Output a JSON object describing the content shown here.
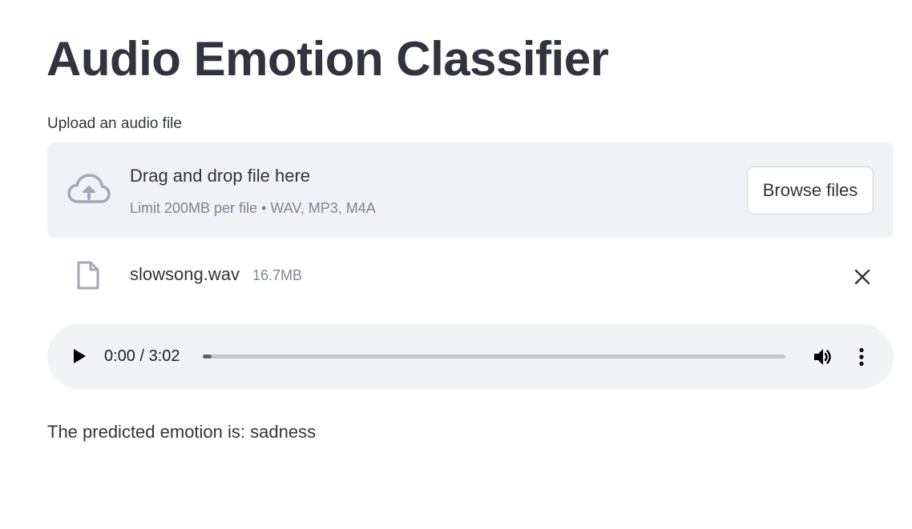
{
  "header": {
    "title": "Audio Emotion Classifier"
  },
  "uploader": {
    "label": "Upload an audio file",
    "drop_title": "Drag and drop file here",
    "limit_text": "Limit 200MB per file • WAV, MP3, M4A",
    "browse_label": "Browse files",
    "icon": "cloud-upload-icon"
  },
  "uploaded_file": {
    "name": "slowsong.wav",
    "size": "16.7MB",
    "icon": "file-icon",
    "remove_icon": "close-icon"
  },
  "audio_player": {
    "time": "0:00 / 3:02",
    "progress": 0.015,
    "play_icon": "play-icon",
    "volume_icon": "volume-icon",
    "menu_icon": "more-vertical-icon"
  },
  "result": {
    "text": "The predicted emotion is: sadness"
  },
  "colors": {
    "text": "#31333f",
    "muted": "#808495",
    "dropzone_bg": "#f0f2f6",
    "icon_gray": "#a3a8b8",
    "player_bg": "#f1f3f4"
  }
}
